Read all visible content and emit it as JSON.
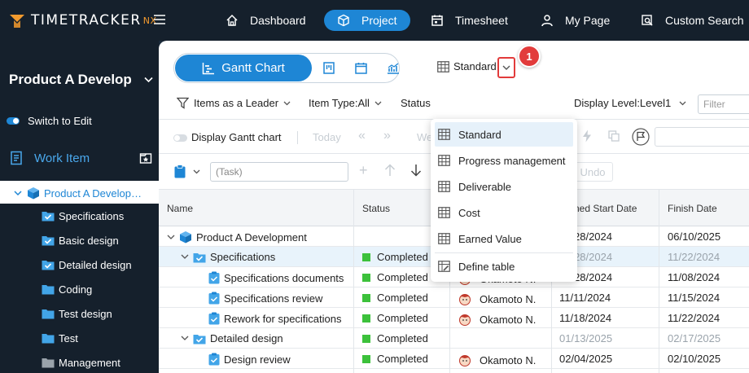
{
  "brand": {
    "name": "TIMETRACKER",
    "suffix": "NX",
    "accent": "#f29a2e"
  },
  "nav": [
    {
      "label": "Dashboard",
      "icon": "home-icon"
    },
    {
      "label": "Project",
      "icon": "cube-icon",
      "active": true
    },
    {
      "label": "Timesheet",
      "icon": "calendar-icon"
    },
    {
      "label": "My Page",
      "icon": "person-icon"
    },
    {
      "label": "Custom Search",
      "icon": "search-doc-icon"
    }
  ],
  "sidebar": {
    "project_title": "Product A Develop",
    "switch_label": "Switch to Edit",
    "section_label": "Work Item",
    "tree_root": "Product A Develop…",
    "items": [
      {
        "label": "Specifications",
        "icon": "folder-check-icon"
      },
      {
        "label": "Basic design",
        "icon": "folder-check-icon"
      },
      {
        "label": "Detailed design",
        "icon": "folder-check-icon"
      },
      {
        "label": "Coding",
        "icon": "folder-icon"
      },
      {
        "label": "Test design",
        "icon": "folder-icon"
      },
      {
        "label": "Test",
        "icon": "folder-icon"
      },
      {
        "label": "Management",
        "icon": "folder-grey-icon"
      }
    ]
  },
  "toolbar": {
    "gantt_label": "Gantt Chart",
    "table_select": "Standard",
    "callout_number": "1",
    "filters": {
      "leader": "Items as a Leader",
      "item_type": "Item Type:All",
      "status": "Status",
      "display_level": "Display Level:Level1",
      "filter_placeholder": "Filter"
    },
    "display_gantt": "Display Gantt chart",
    "today": "Today",
    "we_partial": "We",
    "task_placeholder": "(Task)",
    "undo": "Undo"
  },
  "dropdown": {
    "items": [
      {
        "label": "Standard",
        "active": true
      },
      {
        "label": "Progress management"
      },
      {
        "label": "Deliverable"
      },
      {
        "label": "Cost"
      },
      {
        "label": "Earned Value"
      },
      {
        "label": "Define table",
        "icon": "edit-table-icon"
      }
    ]
  },
  "table": {
    "headers": {
      "name": "Name",
      "status": "Status",
      "planned_start": "ned Start Date",
      "finish": "Finish Date"
    },
    "rows": [
      {
        "name": "Product A Development",
        "status": "",
        "assignee": "",
        "start": "28/2024",
        "finish": "06/10/2025",
        "level": 0,
        "icon": "cube-icon",
        "expand": true
      },
      {
        "name": "Specifications",
        "status": "Completed",
        "assignee": "",
        "start": "10/28/2024",
        "finish": "11/22/2024",
        "level": 1,
        "icon": "folder-check-icon",
        "expand": true,
        "selected": true,
        "grey_dates": true
      },
      {
        "name": "Specifications documents",
        "status": "Completed",
        "assignee": "Okamoto N.",
        "start": "10/28/2024",
        "finish": "11/08/2024",
        "level": 2,
        "icon": "task-icon"
      },
      {
        "name": "Specifications review",
        "status": "Completed",
        "assignee": "Okamoto N.",
        "start": "11/11/2024",
        "finish": "11/15/2024",
        "level": 2,
        "icon": "task-icon"
      },
      {
        "name": "Rework for specifications",
        "status": "Completed",
        "assignee": "Okamoto N.",
        "start": "11/18/2024",
        "finish": "11/22/2024",
        "level": 2,
        "icon": "task-icon"
      },
      {
        "name": "Detailed design",
        "status": "Completed",
        "assignee": "",
        "start": "01/13/2025",
        "finish": "02/17/2025",
        "level": 1,
        "icon": "folder-check-icon",
        "expand": true,
        "grey_dates": true
      },
      {
        "name": "Design review",
        "status": "Completed",
        "assignee": "Okamoto N.",
        "start": "02/04/2025",
        "finish": "02/10/2025",
        "level": 2,
        "icon": "task-icon"
      }
    ]
  },
  "colors": {
    "primary": "#1e86d5",
    "sidebar_bg": "#15202c",
    "completed": "#3cc13b",
    "callout": "#e23b3b"
  }
}
